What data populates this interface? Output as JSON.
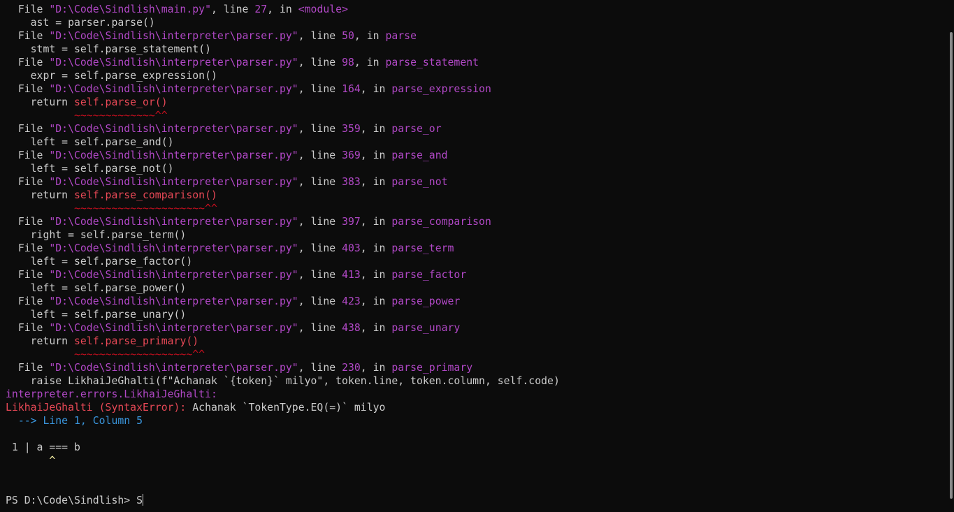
{
  "trace": [
    {
      "kind": "file",
      "pre": "  File ",
      "path": "\"D:\\Code\\Sindlish\\main.py\"",
      "mid": ", line ",
      "num": "27",
      "in": ", in ",
      "func": "<module>"
    },
    {
      "kind": "code",
      "text": "    ast = parser.parse()"
    },
    {
      "kind": "file",
      "pre": "  File ",
      "path": "\"D:\\Code\\Sindlish\\interpreter\\parser.py\"",
      "mid": ", line ",
      "num": "50",
      "in": ", in ",
      "func": "parse"
    },
    {
      "kind": "code",
      "text": "    stmt = self.parse_statement()"
    },
    {
      "kind": "file",
      "pre": "  File ",
      "path": "\"D:\\Code\\Sindlish\\interpreter\\parser.py\"",
      "mid": ", line ",
      "num": "98",
      "in": ", in ",
      "func": "parse_statement"
    },
    {
      "kind": "code",
      "text": "    expr = self.parse_expression()"
    },
    {
      "kind": "file",
      "pre": "  File ",
      "path": "\"D:\\Code\\Sindlish\\interpreter\\parser.py\"",
      "mid": ", line ",
      "num": "164",
      "in": ", in ",
      "func": "parse_expression"
    },
    {
      "kind": "codehl",
      "pre": "    return ",
      "hl": "self.parse_or()"
    },
    {
      "kind": "tilde",
      "text": "           ~~~~~~~~~~~~~^^"
    },
    {
      "kind": "file",
      "pre": "  File ",
      "path": "\"D:\\Code\\Sindlish\\interpreter\\parser.py\"",
      "mid": ", line ",
      "num": "359",
      "in": ", in ",
      "func": "parse_or"
    },
    {
      "kind": "code",
      "text": "    left = self.parse_and()"
    },
    {
      "kind": "file",
      "pre": "  File ",
      "path": "\"D:\\Code\\Sindlish\\interpreter\\parser.py\"",
      "mid": ", line ",
      "num": "369",
      "in": ", in ",
      "func": "parse_and"
    },
    {
      "kind": "code",
      "text": "    left = self.parse_not()"
    },
    {
      "kind": "file",
      "pre": "  File ",
      "path": "\"D:\\Code\\Sindlish\\interpreter\\parser.py\"",
      "mid": ", line ",
      "num": "383",
      "in": ", in ",
      "func": "parse_not"
    },
    {
      "kind": "codehl",
      "pre": "    return ",
      "hl": "self.parse_comparison()"
    },
    {
      "kind": "tilde",
      "text": "           ~~~~~~~~~~~~~~~~~~~~~^^"
    },
    {
      "kind": "file",
      "pre": "  File ",
      "path": "\"D:\\Code\\Sindlish\\interpreter\\parser.py\"",
      "mid": ", line ",
      "num": "397",
      "in": ", in ",
      "func": "parse_comparison"
    },
    {
      "kind": "code",
      "text": "    right = self.parse_term()"
    },
    {
      "kind": "file",
      "pre": "  File ",
      "path": "\"D:\\Code\\Sindlish\\interpreter\\parser.py\"",
      "mid": ", line ",
      "num": "403",
      "in": ", in ",
      "func": "parse_term"
    },
    {
      "kind": "code",
      "text": "    left = self.parse_factor()"
    },
    {
      "kind": "file",
      "pre": "  File ",
      "path": "\"D:\\Code\\Sindlish\\interpreter\\parser.py\"",
      "mid": ", line ",
      "num": "413",
      "in": ", in ",
      "func": "parse_factor"
    },
    {
      "kind": "code",
      "text": "    left = self.parse_power()"
    },
    {
      "kind": "file",
      "pre": "  File ",
      "path": "\"D:\\Code\\Sindlish\\interpreter\\parser.py\"",
      "mid": ", line ",
      "num": "423",
      "in": ", in ",
      "func": "parse_power"
    },
    {
      "kind": "code",
      "text": "    left = self.parse_unary()"
    },
    {
      "kind": "file",
      "pre": "  File ",
      "path": "\"D:\\Code\\Sindlish\\interpreter\\parser.py\"",
      "mid": ", line ",
      "num": "438",
      "in": ", in ",
      "func": "parse_unary"
    },
    {
      "kind": "codehl",
      "pre": "    return ",
      "hl": "self.parse_primary()"
    },
    {
      "kind": "tilde",
      "text": "           ~~~~~~~~~~~~~~~~~~~^^"
    },
    {
      "kind": "file",
      "pre": "  File ",
      "path": "\"D:\\Code\\Sindlish\\interpreter\\parser.py\"",
      "mid": ", line ",
      "num": "230",
      "in": ", in ",
      "func": "parse_primary"
    },
    {
      "kind": "code",
      "text": "    raise LikhaiJeGhalti(f\"Achanak `{token}` milyo\", token.line, token.column, self.code)"
    }
  ],
  "exception_class": "interpreter.errors.LikhaiJeGhalti:",
  "error": {
    "name": "LikhaiJeGhalti (SyntaxError):",
    "message": " Achanak `TokenType.EQ(=)` milyo"
  },
  "location": {
    "arrow": "  --> ",
    "text": "Line 1, Column 5"
  },
  "source": {
    "gutter": " 1 | ",
    "code": "a === b",
    "caret_pad": "       ",
    "caret": "^"
  },
  "prompt": {
    "text": "PS D:\\Code\\Sindlish> ",
    "input": "S"
  },
  "colors": {
    "background": "#0c0c0c",
    "text": "#cccccc",
    "purple": "#b148c6",
    "red": "#e74856",
    "cyan": "#3a96dd",
    "yellow": "#f9f1a5"
  }
}
